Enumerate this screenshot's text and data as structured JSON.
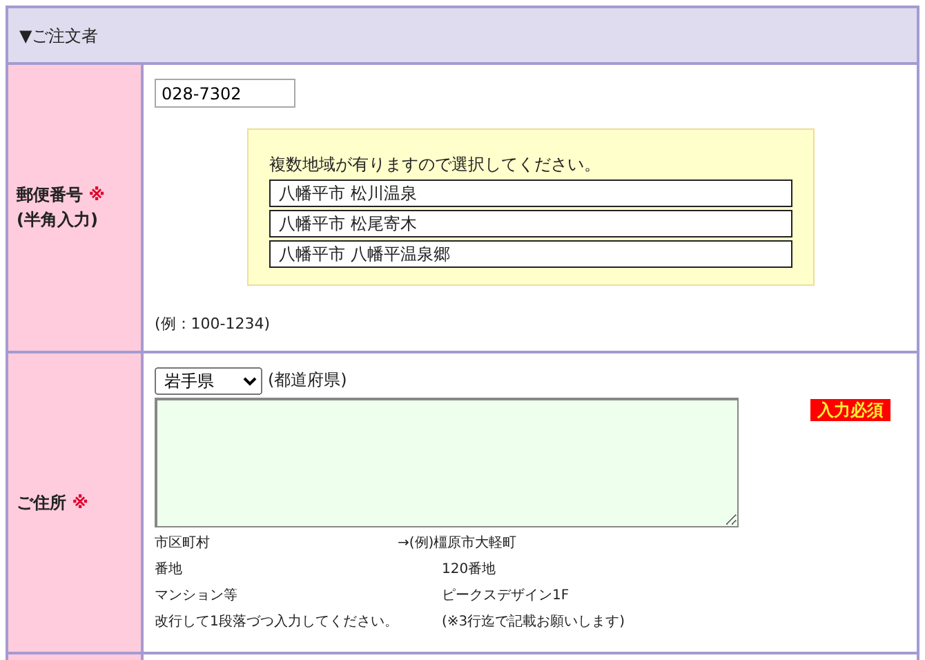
{
  "section_header": "▼ご注文者",
  "postal": {
    "label": "郵便番号",
    "required_mark": "※",
    "sublabel": "(半角入力)",
    "value": "028-7302",
    "choices_prompt": "複数地域が有りますので選択してください。",
    "choices": [
      {
        "text": "八幡平市 松川温泉"
      },
      {
        "text": "八幡平市 松尾寄木"
      },
      {
        "text": "八幡平市 八幡平温泉郷"
      }
    ],
    "example": "(例：100-1234)"
  },
  "address": {
    "label": "ご住所",
    "required_mark": "※",
    "prefecture": "岩手県",
    "prefecture_note": "(都道府県)",
    "required_badge": "入力必須",
    "hints": [
      {
        "left": "市区町村",
        "right": "→(例)橿原市大軽町"
      },
      {
        "left": "番地",
        "right": "120番地"
      },
      {
        "left": "マンション等",
        "right": "ピークスデザイン1F"
      },
      {
        "left": "改行して1段落づつ入力してください。",
        "right": "(※3行迄で記載お願いします)"
      }
    ]
  }
}
